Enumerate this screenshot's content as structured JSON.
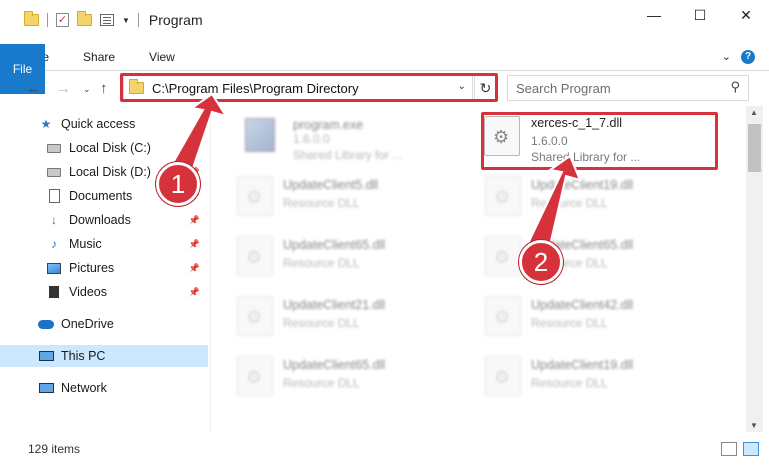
{
  "window": {
    "title": "Program",
    "minimize_icon": "minimize-icon",
    "maximize_icon": "maximize-icon",
    "close_icon": "close-icon"
  },
  "ribbon": {
    "tabs": [
      "File",
      "Home",
      "Share",
      "View"
    ]
  },
  "nav": {
    "address": "C:\\Program Files\\Program Directory",
    "search_placeholder": "Search Program"
  },
  "sidebar": {
    "items": [
      {
        "label": "Quick access",
        "icon": "star-icon"
      },
      {
        "label": "Local Disk (C:)",
        "icon": "disk-icon",
        "pinned": true
      },
      {
        "label": "Local Disk (D:)",
        "icon": "disk-icon",
        "pinned": true
      },
      {
        "label": "Documents",
        "icon": "document-icon",
        "pinned": true
      },
      {
        "label": "Downloads",
        "icon": "download-icon",
        "pinned": true
      },
      {
        "label": "Music",
        "icon": "music-icon",
        "pinned": true
      },
      {
        "label": "Pictures",
        "icon": "pictures-icon",
        "pinned": true
      },
      {
        "label": "Videos",
        "icon": "videos-icon",
        "pinned": true
      },
      {
        "label": "OneDrive",
        "icon": "cloud-icon"
      },
      {
        "label": "This PC",
        "icon": "computer-icon",
        "selected": true
      },
      {
        "label": "Network",
        "icon": "network-icon"
      }
    ]
  },
  "files": [
    {
      "name": "program.exe",
      "detail": "1.6.0.0",
      "desc": "Shared Library for ...",
      "blurred": true
    },
    {
      "name": "xerces-c_1_7.dll",
      "detail": "1.6.0.0",
      "desc": "Shared Library for ...",
      "blurred": false
    },
    {
      "name": "UpdateClient5.dll",
      "detail": "Resource DLL",
      "blurred": true
    },
    {
      "name": "UpdateClient19.dll",
      "detail": "Resource DLL",
      "blurred": true
    },
    {
      "name": "UpdateClient65.dll",
      "detail": "Resource DLL",
      "blurred": true
    },
    {
      "name": "UpdateClient65.dll",
      "detail": "Resource DLL",
      "blurred": true
    },
    {
      "name": "UpdateClient21.dll",
      "detail": "Resource DLL",
      "blurred": true
    },
    {
      "name": "UpdateClient42.dll",
      "detail": "Resource DLL",
      "blurred": true
    },
    {
      "name": "UpdateClient65.dll",
      "detail": "Resource DLL",
      "blurred": true
    },
    {
      "name": "UpdateClient19.dll",
      "detail": "Resource DLL",
      "blurred": true
    }
  ],
  "status": {
    "item_count": "129 items"
  },
  "callouts": {
    "step1": "1",
    "step2": "2",
    "color": "#d6323c"
  }
}
